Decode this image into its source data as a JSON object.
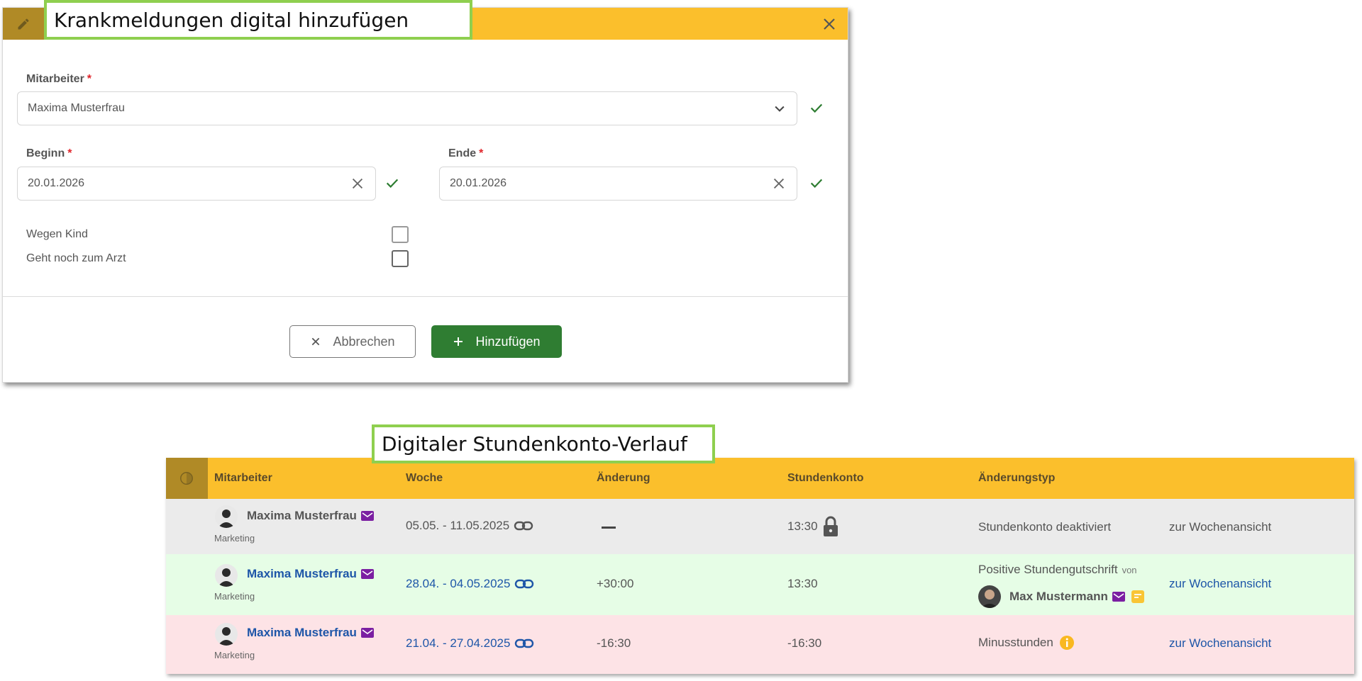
{
  "modal": {
    "title": "Krankmeldungen digital hinzufügen",
    "employee": {
      "label": "Mitarbeiter",
      "required_mark": "*",
      "value": "Maxima Musterfrau"
    },
    "start": {
      "label": "Beginn",
      "required_mark": "*",
      "value": "20.01.2026"
    },
    "end": {
      "label": "Ende",
      "required_mark": "*",
      "value": "20.01.2026"
    },
    "checkboxes": [
      {
        "label": "Wegen Kind",
        "checked": false
      },
      {
        "label": "Geht noch zum Arzt",
        "checked": false
      }
    ],
    "cancel_label": "Abbrechen",
    "add_label": "Hinzufügen"
  },
  "history": {
    "title": "Digitaler Stundenkonto-Verlauf",
    "columns": [
      "Mitarbeiter",
      "Woche",
      "Änderung",
      "Stundenkonto",
      "Änderungstyp"
    ],
    "rows": [
      {
        "employee": "Maxima Musterfrau",
        "department": "Marketing",
        "week": "05.05. - 11.05.2025",
        "change": "—",
        "balance": "13:30",
        "change_type": "Stundenkonto deaktiviert",
        "link": "zur Wochenansicht"
      },
      {
        "employee": "Maxima Musterfrau",
        "department": "Marketing",
        "week": "28.04. - 04.05.2025",
        "change": "+30:00",
        "balance": "13:30",
        "change_type": "Positive Stundengutschrift",
        "by_label": "von",
        "by_user": "Max Mustermann",
        "link": "zur Wochenansicht"
      },
      {
        "employee": "Maxima Musterfrau",
        "department": "Marketing",
        "week": "21.04. - 27.04.2025",
        "change": "-16:30",
        "balance": "-16:30",
        "change_type": "Minusstunden",
        "link": "zur Wochenansicht"
      }
    ]
  },
  "colors": {
    "header_yellow": "#fbbf2c",
    "header_dark": "#b08a26",
    "callout_green": "#8fcf4f",
    "ok_green": "#2e7d32",
    "link_blue": "#1e56a8",
    "mail_purple": "#7b1fa2",
    "row_disabled": "#ebebeb",
    "row_positive": "#e6fde6",
    "row_negative": "#fde3e6"
  }
}
